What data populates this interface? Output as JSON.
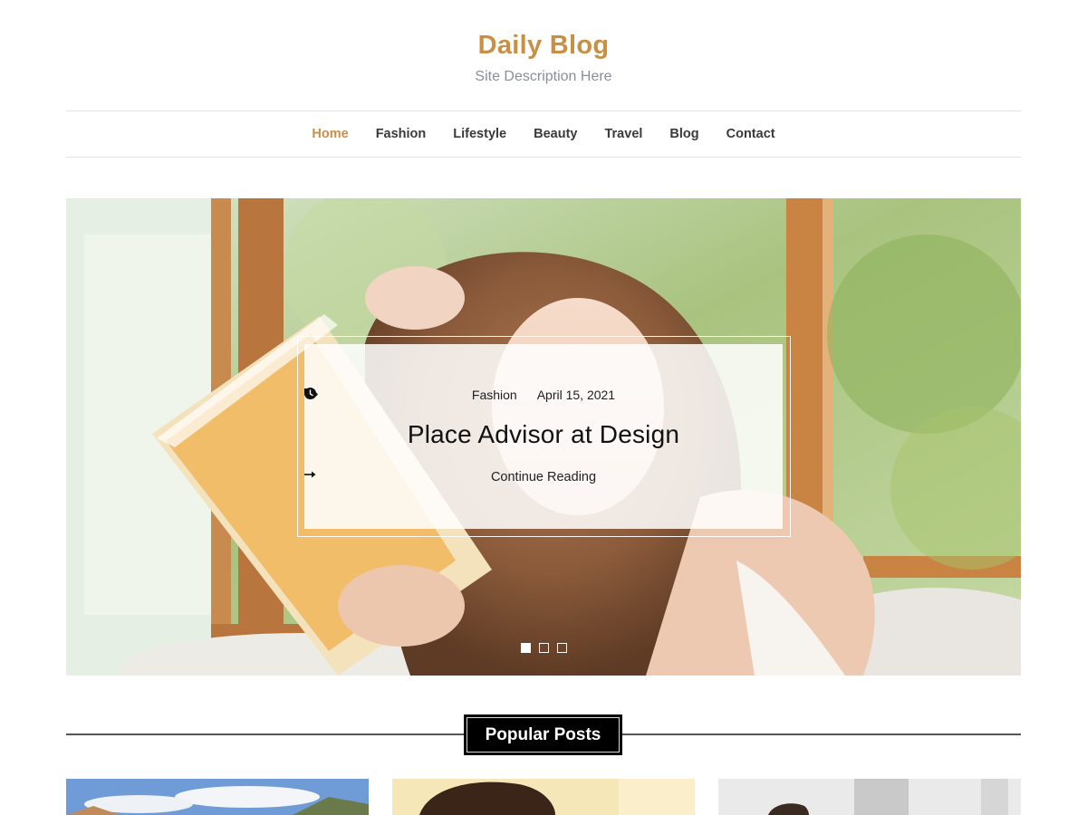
{
  "site": {
    "title": "Daily Blog",
    "description": "Site Description Here",
    "accent_color": "#c98f45"
  },
  "nav": {
    "items": [
      {
        "label": "Home",
        "active": true
      },
      {
        "label": "Fashion",
        "active": false
      },
      {
        "label": "Lifestyle",
        "active": false
      },
      {
        "label": "Beauty",
        "active": false
      },
      {
        "label": "Travel",
        "active": false
      },
      {
        "label": "Blog",
        "active": false
      },
      {
        "label": "Contact",
        "active": false
      }
    ]
  },
  "hero": {
    "category": "Fashion",
    "category_icon": "tags-icon",
    "date": "April 15, 2021",
    "date_icon": "clock-icon",
    "title": "Place Advisor at Design",
    "continue_label": "Continue Reading",
    "continue_icon": "arrow-right-icon",
    "slides_count": 3,
    "active_slide": 1
  },
  "popular": {
    "heading": "Popular Posts"
  }
}
